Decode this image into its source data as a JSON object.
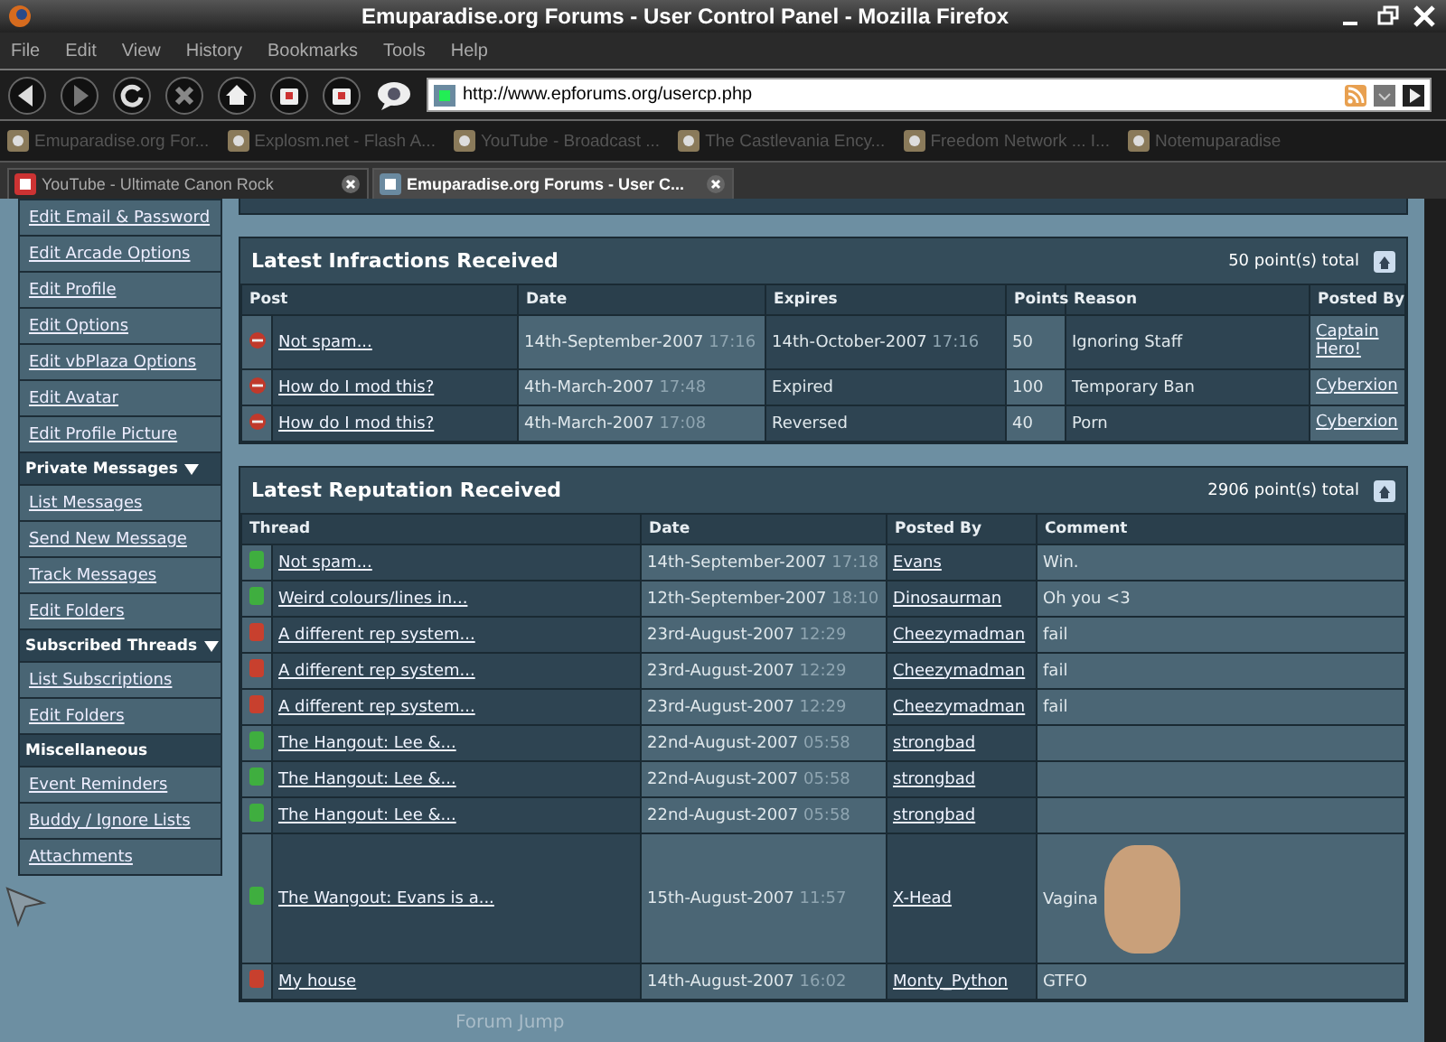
{
  "window": {
    "title": "Emuparadise.org Forums - User Control Panel - Mozilla Firefox"
  },
  "menu": [
    "File",
    "Edit",
    "View",
    "History",
    "Bookmarks",
    "Tools",
    "Help"
  ],
  "address": {
    "value": "http://www.epforums.org/usercp.php"
  },
  "bookmarks": [
    {
      "label": "Emuparadise.org For..."
    },
    {
      "label": "Explosm.net - Flash A..."
    },
    {
      "label": "YouTube - Broadcast ..."
    },
    {
      "label": "The Castlevania Ency..."
    },
    {
      "label": "Freedom Network ... I..."
    },
    {
      "label": "Notemuparadise"
    }
  ],
  "tabs": [
    {
      "label": "YouTube - Ultimate Canon Rock",
      "selected": false
    },
    {
      "label": "Emuparadise.org Forums - User C...",
      "selected": true
    }
  ],
  "sidebar": {
    "items": [
      {
        "kind": "link",
        "label": "Edit Email & Password"
      },
      {
        "kind": "link",
        "label": "Edit Arcade Options"
      },
      {
        "kind": "link",
        "label": "Edit Profile"
      },
      {
        "kind": "link",
        "label": "Edit Options"
      },
      {
        "kind": "link",
        "label": "Edit vbPlaza Options"
      },
      {
        "kind": "link",
        "label": "Edit Avatar"
      },
      {
        "kind": "link",
        "label": "Edit Profile Picture"
      },
      {
        "kind": "header",
        "label": "Private Messages",
        "expanded": true
      },
      {
        "kind": "link",
        "label": "List Messages"
      },
      {
        "kind": "link",
        "label": "Send New Message"
      },
      {
        "kind": "link",
        "label": "Track Messages"
      },
      {
        "kind": "link",
        "label": "Edit Folders"
      },
      {
        "kind": "header",
        "label": "Subscribed Threads",
        "expanded": true
      },
      {
        "kind": "link",
        "label": "List Subscriptions"
      },
      {
        "kind": "link",
        "label": "Edit Folders"
      },
      {
        "kind": "header",
        "label": "Miscellaneous",
        "expanded": false
      },
      {
        "kind": "link",
        "label": "Event Reminders"
      },
      {
        "kind": "link",
        "label": "Buddy / Ignore Lists"
      },
      {
        "kind": "link",
        "label": "Attachments"
      }
    ]
  },
  "infractions": {
    "title": "Latest Infractions Received",
    "total": "50 point(s) total",
    "columns": [
      "Post",
      "Date",
      "Expires",
      "Points",
      "Reason",
      "Posted By"
    ],
    "rows": [
      {
        "post": "Not spam...",
        "date": "14th-September-2007",
        "time": "17:16",
        "expires": "14th-October-2007",
        "expires_time": "17:16",
        "points": "50",
        "reason": "Ignoring Staff",
        "posted_by": "Captain Hero!"
      },
      {
        "post": "How do I mod this?",
        "date": "4th-March-2007",
        "time": "17:48",
        "expires": "Expired",
        "points": "100",
        "reason": "Temporary Ban",
        "posted_by": "Cyberxion"
      },
      {
        "post": "How do I mod this?",
        "date": "4th-March-2007",
        "time": "17:08",
        "expires": "Reversed",
        "points": "40",
        "reason": "Porn",
        "posted_by": "Cyberxion"
      }
    ]
  },
  "reputation": {
    "title": "Latest Reputation Received",
    "total": "2906 point(s) total",
    "columns": [
      "Thread",
      "Date",
      "Posted By",
      "Comment"
    ],
    "rows": [
      {
        "thread": "Not spam...",
        "date": "14th-September-2007",
        "time": "17:18",
        "posted_by": "Evans",
        "comment": "Win.",
        "color": "#3fae3f",
        "image": false
      },
      {
        "thread": "Weird colours/lines in...",
        "date": "12th-September-2007",
        "time": "18:10",
        "posted_by": "Dinosaurman",
        "comment": "Oh you <3",
        "color": "#3fae3f",
        "image": false
      },
      {
        "thread": "A different rep system...",
        "date": "23rd-August-2007",
        "time": "12:29",
        "posted_by": "Cheezymadman",
        "comment": "fail",
        "color": "#c8402e",
        "image": false
      },
      {
        "thread": "A different rep system...",
        "date": "23rd-August-2007",
        "time": "12:29",
        "posted_by": "Cheezymadman",
        "comment": "fail",
        "color": "#c8402e",
        "image": false
      },
      {
        "thread": "A different rep system...",
        "date": "23rd-August-2007",
        "time": "12:29",
        "posted_by": "Cheezymadman",
        "comment": "fail",
        "color": "#c8402e",
        "image": false
      },
      {
        "thread": "The Hangout: Lee &...",
        "date": "22nd-August-2007",
        "time": "05:58",
        "posted_by": "strongbad",
        "color": "#3fae3f",
        "image": false
      },
      {
        "thread": "The Hangout: Lee &...",
        "date": "22nd-August-2007",
        "time": "05:58",
        "posted_by": "strongbad",
        "color": "#3fae3f",
        "image": false
      },
      {
        "thread": "The Hangout: Lee &...",
        "date": "22nd-August-2007",
        "time": "05:58",
        "posted_by": "strongbad",
        "color": "#3fae3f",
        "image": false
      },
      {
        "thread": "The Wangout: Evans is a...",
        "date": "15th-August-2007",
        "time": "11:57",
        "posted_by": "X-Head",
        "comment": "Vagina",
        "color": "#3fae3f",
        "image": true
      },
      {
        "thread": "My house",
        "date": "14th-August-2007",
        "time": "16:02",
        "posted_by": "Monty_Python",
        "comment": "GTFO",
        "color": "#c8402e",
        "image": false
      }
    ]
  },
  "forum_jump": "Forum Jump"
}
